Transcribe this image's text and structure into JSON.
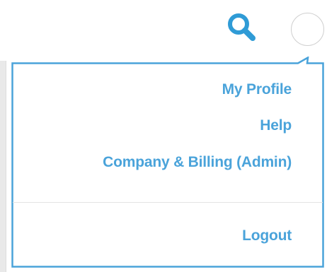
{
  "header": {
    "search_icon": "search-icon",
    "avatar": "user-avatar"
  },
  "menu": {
    "items": [
      {
        "label": "My Profile"
      },
      {
        "label": "Help"
      },
      {
        "label": "Company & Billing (Admin)"
      }
    ],
    "logout_label": "Logout"
  },
  "colors": {
    "accent": "#4aa3da",
    "avatar_border": "#cfcfcf",
    "divider": "#e3e3e3"
  }
}
